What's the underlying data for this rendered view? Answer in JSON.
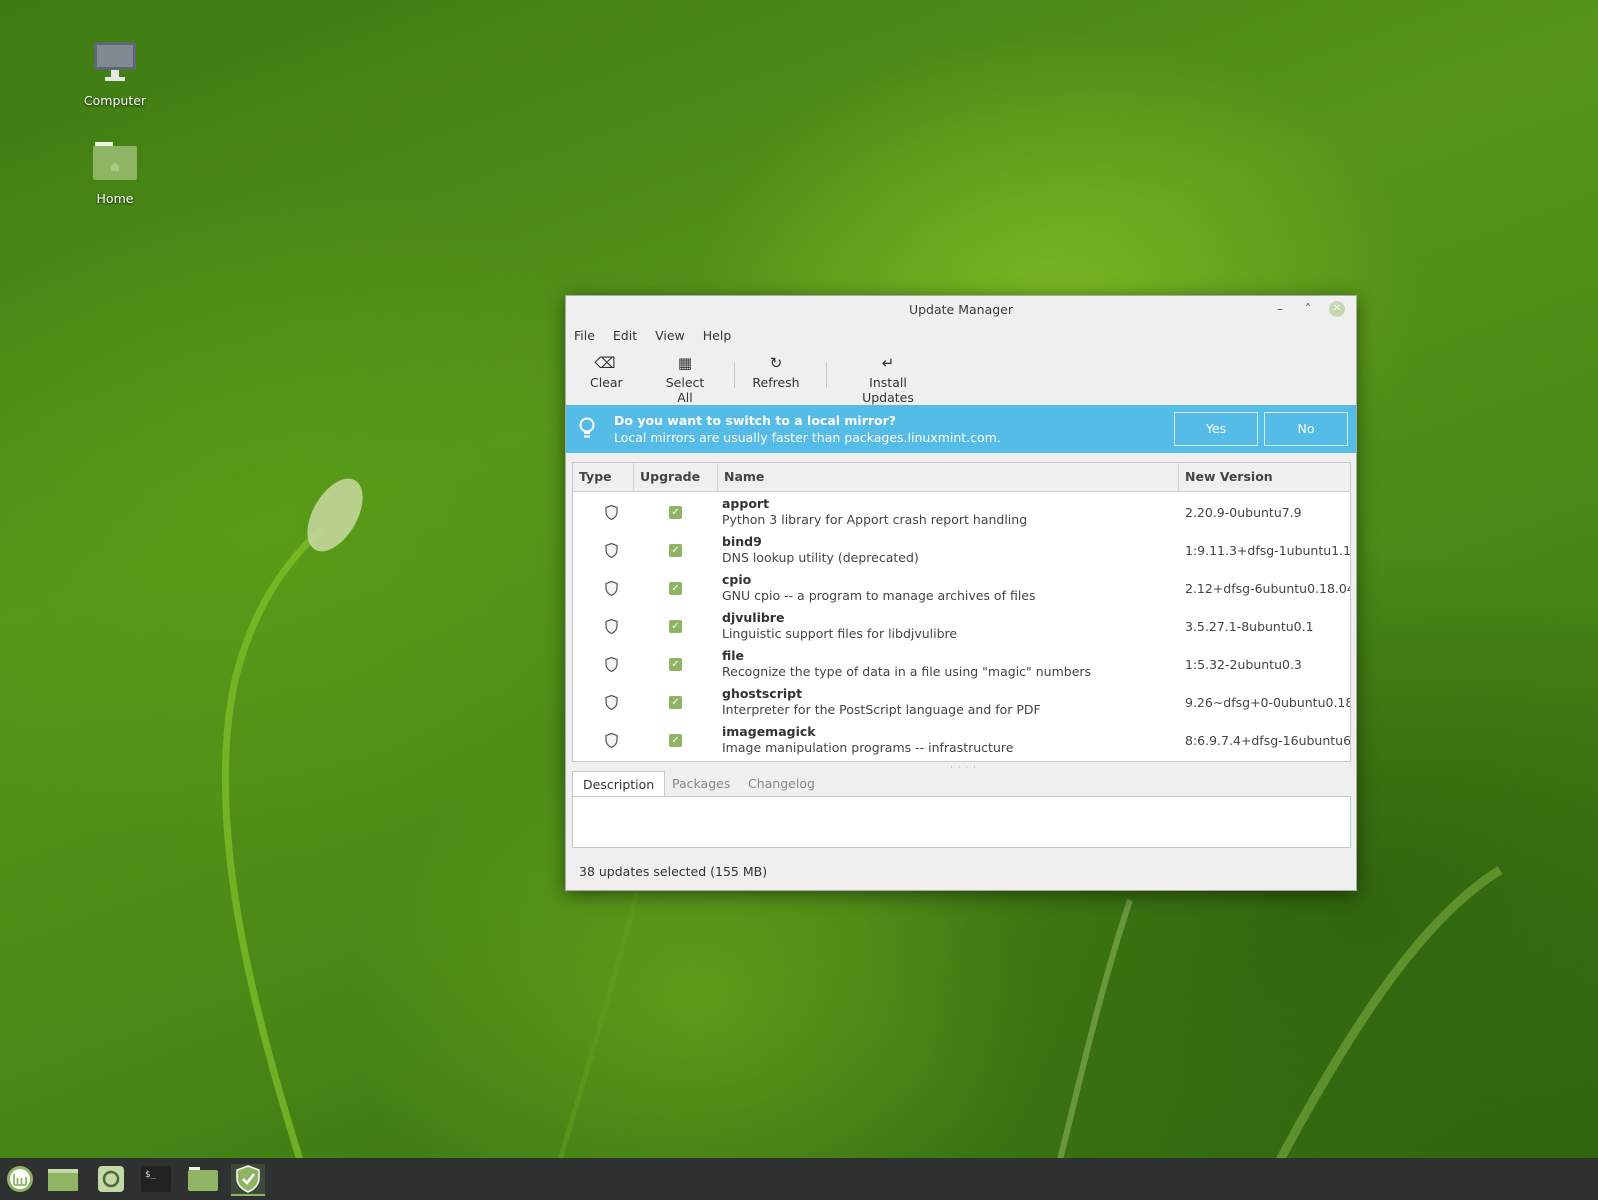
{
  "desktop": {
    "icons": [
      {
        "label": "Computer",
        "icon": "computer-icon"
      },
      {
        "label": "Home",
        "icon": "home-folder-icon"
      }
    ]
  },
  "window": {
    "title": "Update Manager",
    "controls": {
      "minimize": "–",
      "maximize": "˄",
      "close": "✕"
    },
    "menu": [
      "File",
      "Edit",
      "View",
      "Help"
    ],
    "toolbar": {
      "clear": "Clear",
      "select_all": "Select All",
      "refresh": "Refresh",
      "install_updates": "Install Updates"
    },
    "infobar": {
      "title": "Do you want to switch to a local mirror?",
      "message": "Local mirrors are usually faster than packages.linuxmint.com.",
      "yes": "Yes",
      "no": "No"
    },
    "table": {
      "columns": [
        "Type",
        "Upgrade",
        "Name",
        "New Version"
      ],
      "rows": [
        {
          "name": "apport",
          "description": "Python 3 library for Apport crash report handling",
          "version": "2.20.9-0ubuntu7.9"
        },
        {
          "name": "bind9",
          "description": "DNS lookup utility (deprecated)",
          "version": "1:9.11.3+dfsg-1ubuntu1.1"
        },
        {
          "name": "cpio",
          "description": "GNU cpio -- a program to manage archives of files",
          "version": "2.12+dfsg-6ubuntu0.18.04"
        },
        {
          "name": "djvulibre",
          "description": "Linguistic support files for libdjvulibre",
          "version": "3.5.27.1-8ubuntu0.1"
        },
        {
          "name": "file",
          "description": "Recognize the type of data in a file using \"magic\" numbers",
          "version": "1:5.32-2ubuntu0.3"
        },
        {
          "name": "ghostscript",
          "description": "Interpreter for the PostScript language and for PDF",
          "version": "9.26~dfsg+0-0ubuntu0.18"
        },
        {
          "name": "imagemagick",
          "description": "Image manipulation programs -- infrastructure",
          "version": "8:6.9.7.4+dfsg-16ubuntu6."
        }
      ]
    },
    "tabs": [
      "Description",
      "Packages",
      "Changelog"
    ],
    "status": "38 updates selected (155 MB)"
  },
  "taskbar": {
    "items": [
      "mint-menu-icon",
      "show-desktop-icon",
      "software-icon",
      "terminal-icon",
      "files-icon",
      "update-manager-shield-icon"
    ]
  },
  "colors": {
    "infobar": "#55bbe7",
    "accent": "#8fb464",
    "taskbar": "#2f3130"
  }
}
